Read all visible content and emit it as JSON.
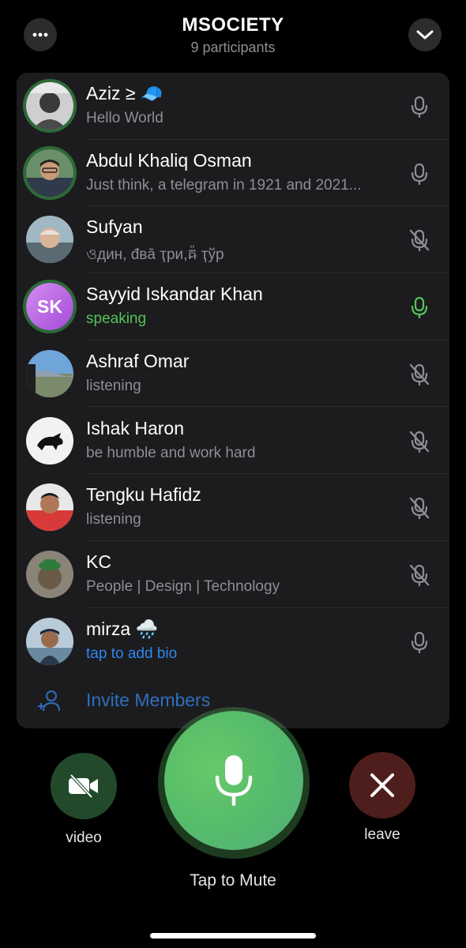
{
  "header": {
    "title": "MSOCIETY",
    "subtitle": "9 participants",
    "more_icon": "ellipsis-icon",
    "collapse_icon": "chevron-down-icon"
  },
  "participants": [
    {
      "name": "Aziz ≥ 🧢",
      "status": "Hello World",
      "mic": "on",
      "status_type": "normal"
    },
    {
      "name": "Abdul Khaliq Osman",
      "status": "Just think, a telegram in 1921 and 2021...",
      "mic": "on",
      "status_type": "normal"
    },
    {
      "name": "Sufyan",
      "status": "ওдин, đвā ҭри,ឝ៉ ҭўр",
      "mic": "muted",
      "status_type": "normal"
    },
    {
      "name": "Sayyid Iskandar Khan",
      "status": "speaking",
      "mic": "speaking",
      "status_type": "speaking",
      "initials": "SK"
    },
    {
      "name": "Ashraf Omar",
      "status": "listening",
      "mic": "muted",
      "status_type": "normal"
    },
    {
      "name": "Ishak Haron",
      "status": "be humble and work hard",
      "mic": "muted",
      "status_type": "normal"
    },
    {
      "name": "Tengku Hafidz",
      "status": "listening",
      "mic": "muted",
      "status_type": "normal"
    },
    {
      "name": "KC",
      "status": "People | Design | Technology",
      "mic": "muted",
      "status_type": "normal"
    },
    {
      "name": "mirza 🌧️",
      "status": "tap to add bio",
      "mic": "on",
      "status_type": "bio"
    }
  ],
  "invite": {
    "label": "Invite Members",
    "icon": "add-person-icon"
  },
  "controls": {
    "video_label": "video",
    "leave_label": "leave",
    "mute_label": "Tap to Mute",
    "video_icon": "video-off-icon",
    "leave_icon": "close-icon",
    "mute_icon": "microphone-icon"
  },
  "colors": {
    "speaking": "#54c35a",
    "bio_link": "#2e86f0",
    "mute_button": "#5cc06a",
    "leave_button": "#4e1e1c",
    "video_button": "#224a2a"
  }
}
